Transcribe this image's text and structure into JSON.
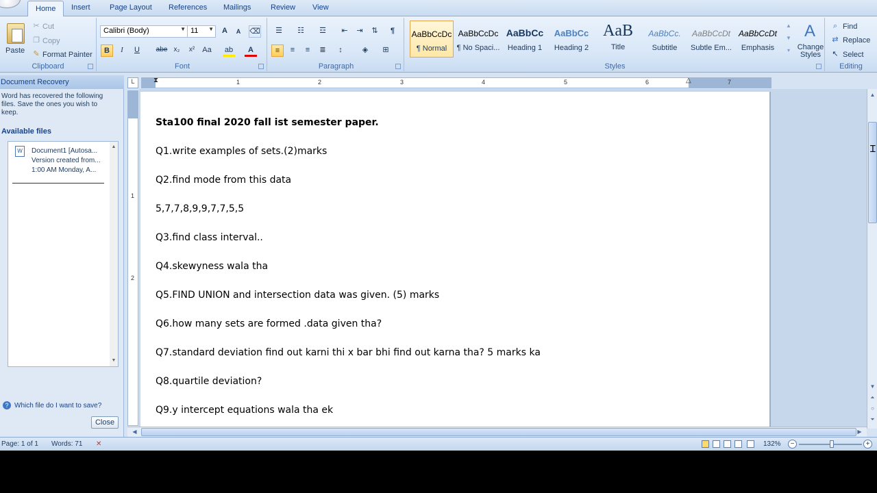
{
  "tabs": [
    "Home",
    "Insert",
    "Page Layout",
    "References",
    "Mailings",
    "Review",
    "View"
  ],
  "clipboard": {
    "group_label": "Clipboard",
    "paste": "Paste",
    "cut": "Cut",
    "copy": "Copy",
    "format_painter": "Format Painter"
  },
  "font": {
    "group_label": "Font",
    "font_name": "Calibri (Body)",
    "font_size": "11",
    "bold": "B",
    "italic": "I",
    "underline": "U",
    "strike": "abe",
    "subscript": "x₂",
    "superscript": "x²",
    "change_case": "Aa",
    "grow": "A",
    "shrink": "A"
  },
  "paragraph": {
    "group_label": "Paragraph",
    "show_marks": "¶"
  },
  "styles": {
    "group_label": "Styles",
    "items": [
      {
        "sample": "AaBbCcDc",
        "name": "¶ Normal"
      },
      {
        "sample": "AaBbCcDc",
        "name": "¶ No Spaci..."
      },
      {
        "sample": "AaBbCc",
        "name": "Heading 1"
      },
      {
        "sample": "AaBbCc",
        "name": "Heading 2"
      },
      {
        "sample": "AaB",
        "name": "Title"
      },
      {
        "sample": "AaBbCc.",
        "name": "Subtitle"
      },
      {
        "sample": "AaBbCcDt",
        "name": "Subtle Em..."
      },
      {
        "sample": "AaBbCcDt",
        "name": "Emphasis"
      }
    ],
    "change_styles": "Change Styles"
  },
  "editing": {
    "group_label": "Editing",
    "find": "Find",
    "replace": "Replace",
    "select": "Select"
  },
  "recovery": {
    "title": "Document Recovery",
    "message": "Word has recovered the following files.  Save the ones you wish to keep.",
    "available": "Available files",
    "file_name": "Document1  [Autosa...",
    "file_version": "Version created from...",
    "file_time": "1:00 AM Monday, A...",
    "help": "Which file do I want to save?",
    "close": "Close"
  },
  "ruler": {
    "numbers": [
      "1",
      "2",
      "3",
      "4",
      "5",
      "6",
      "7"
    ],
    "vnumbers": [
      "1",
      "2"
    ]
  },
  "document": {
    "lines": [
      "Sta100 final 2020 fall ist semester paper.",
      "Q1.write examples  of sets.(2)marks",
      "Q2.find mode from this data",
      "5,7,7,8,9,9,7,7,5,5",
      "Q3.find class interval..",
      "Q4.skewyness wala tha",
      "Q5.FIND UNION and intersection  data was given. (5) marks",
      "Q6.how many sets are formed .data given tha?",
      "Q7.standard deviation  find out  karni thi  x bar bhi find out karna tha? 5 marks ka",
      "Q8.quartile deviation?",
      "Q9.y intercept  equations  wala tha ek"
    ]
  },
  "status": {
    "page": "Page: 1 of 1",
    "words": "Words: 71",
    "zoom": "132%"
  }
}
